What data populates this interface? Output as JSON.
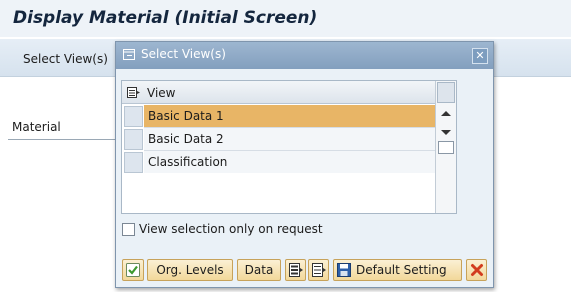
{
  "screen": {
    "title": "Display Material (Initial Screen)",
    "toolbar_button": "Select View(s)",
    "material_label": "Material"
  },
  "dialog": {
    "title": "Select View(s)",
    "close_icon": "close-x-icon",
    "table": {
      "header": "View",
      "rows": [
        "Basic Data 1",
        "Basic Data 2",
        "Classification"
      ],
      "selected_row": 0
    },
    "checkbox": {
      "label": "View selection only on request",
      "checked": false
    },
    "buttons": {
      "org_levels": "Org. Levels",
      "data": "Data",
      "default_setting": "Default Setting"
    }
  },
  "colors": {
    "highlight_row": "#e8b566",
    "dialog_title_bg": "#9db6d0",
    "button_bg": "#f2d89a",
    "cancel_icon": "#d23c1e",
    "ok_icon": "#3c9a2e"
  }
}
